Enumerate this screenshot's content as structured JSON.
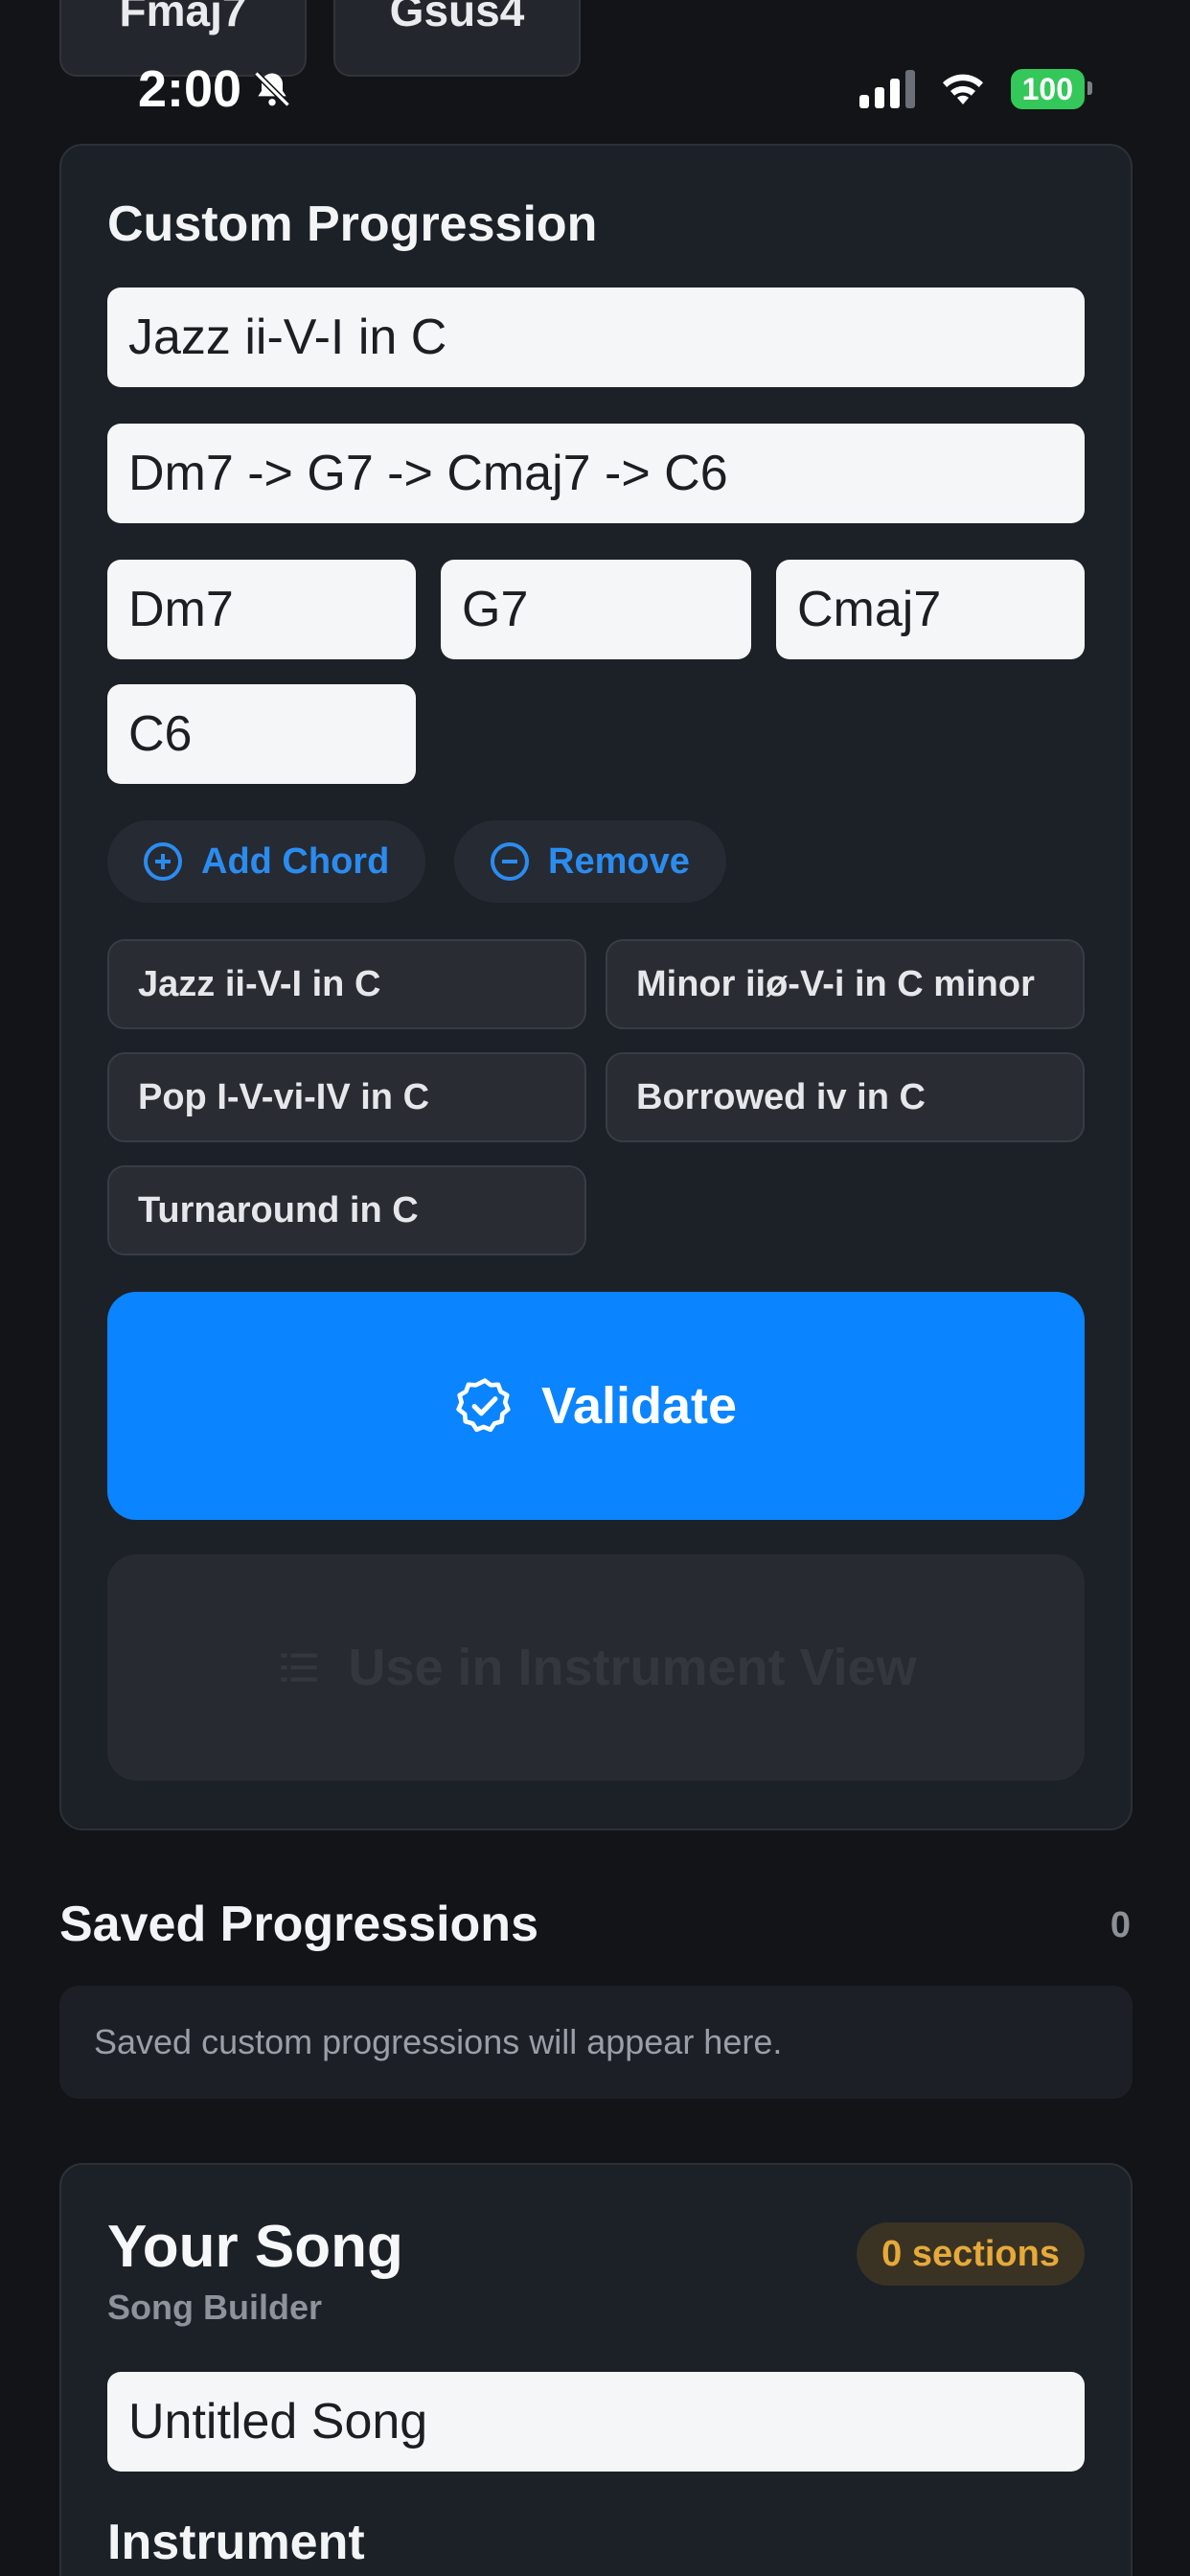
{
  "top_chips": [
    "Fmaj7",
    "Gsus4"
  ],
  "status_bar": {
    "time": "2:00",
    "battery": "100"
  },
  "custom_progression": {
    "title": "Custom Progression",
    "name_value": "Jazz ii-V-I in C",
    "sequence_value": "Dm7 -> G7 -> Cmaj7 -> C6",
    "chords": [
      "Dm7",
      "G7",
      "Cmaj7",
      "C6"
    ],
    "add_chord_label": "Add Chord",
    "remove_label": "Remove",
    "presets": [
      "Jazz ii-V-I in C",
      "Minor iiø-V-i in C minor",
      "Pop I-V-vi-IV in C",
      "Borrowed iv in C",
      "Turnaround in C"
    ],
    "validate_label": "Validate",
    "use_label": "Use in Instrument View"
  },
  "saved_progressions": {
    "title": "Saved Progressions",
    "count": "0",
    "empty_text": "Saved custom progressions will appear here."
  },
  "song": {
    "title": "Your Song",
    "subtitle": "Song Builder",
    "badge": "0 sections",
    "name_value": "Untitled Song",
    "instrument_label": "Instrument"
  },
  "colors": {
    "background": "#121418",
    "card": "#1c2027",
    "accent": "#0a84ff",
    "battery": "#34c759",
    "badge_text": "#e6a93a"
  }
}
